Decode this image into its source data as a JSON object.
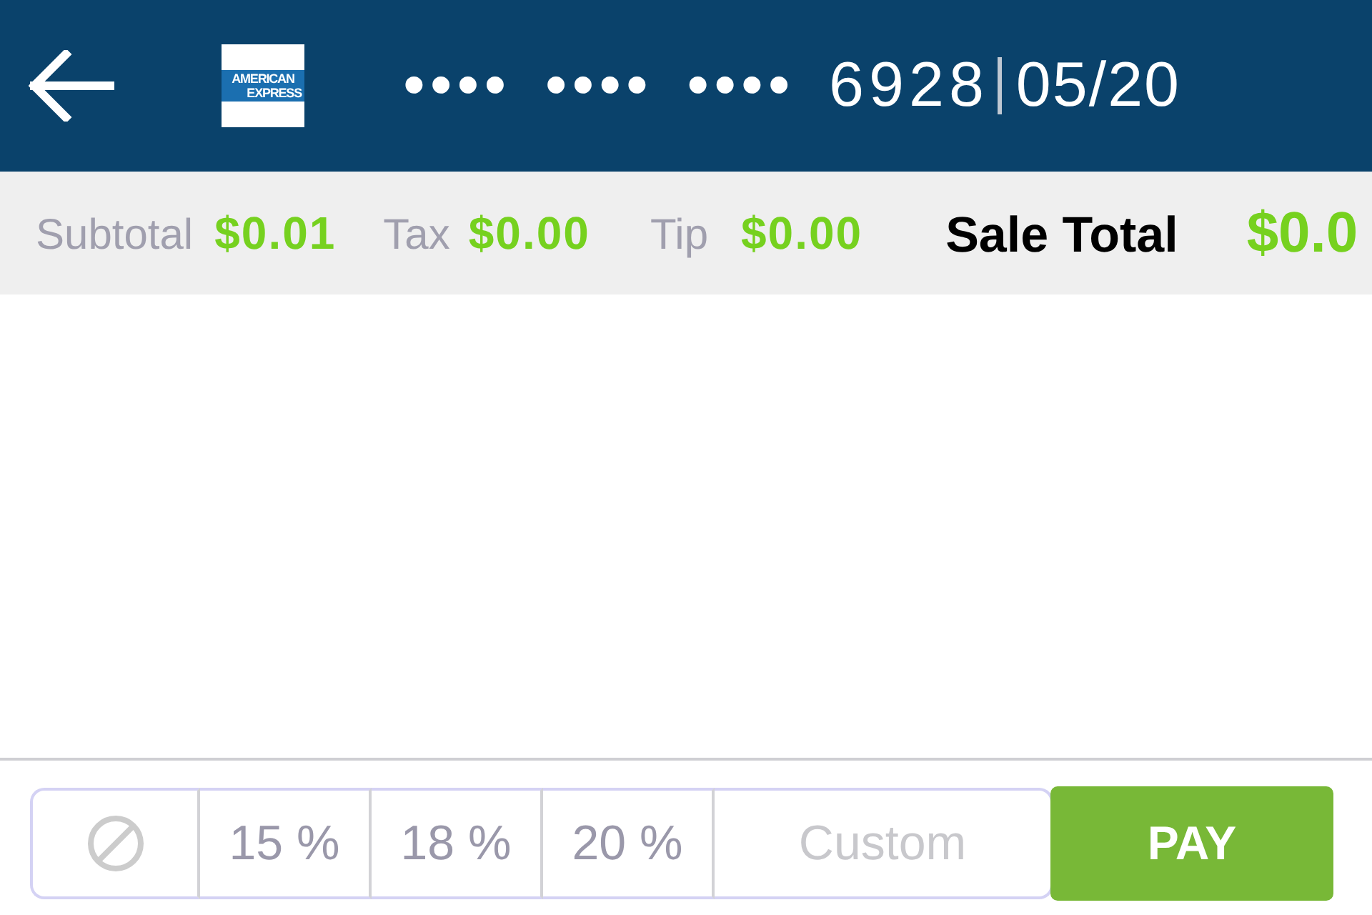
{
  "header": {
    "card_logo": {
      "lines": [
        "AMERICAN",
        "EXPRESS"
      ]
    },
    "card_number": "•••• •••• •••• 6928",
    "expiry": "05/20"
  },
  "summary": {
    "items": [
      {
        "label": "Subtotal",
        "amount": "$0.01"
      },
      {
        "label": "Tax",
        "amount": "$0.00"
      },
      {
        "label": "Tip",
        "amount": "$0.00"
      }
    ],
    "total": {
      "label": "Sale Total",
      "amount": "$0.0"
    }
  },
  "tip_options": [
    {
      "kind": "none",
      "selected": false
    },
    {
      "kind": "percent",
      "label": "15 %",
      "selected": false
    },
    {
      "kind": "percent",
      "label": "18 %",
      "selected": false
    },
    {
      "kind": "percent",
      "label": "20 %",
      "selected": false
    }
  ],
  "custom_tip": {
    "placeholder": "Custom"
  },
  "pay_button": {
    "label": "PAY"
  }
}
